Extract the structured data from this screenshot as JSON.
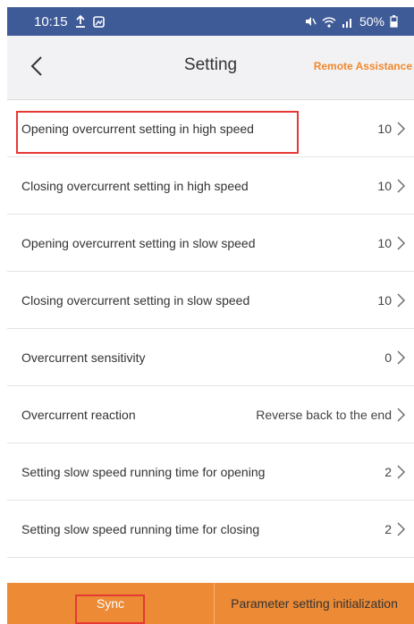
{
  "status_bar": {
    "time": "10:15",
    "battery": "50%",
    "icons": [
      "upload-icon",
      "image-icon",
      "mute-icon",
      "wifi-icon",
      "signal-icon",
      "battery-icon"
    ]
  },
  "header": {
    "title": "Setting",
    "back_icon": "chevron-left-icon",
    "remote_assistance": "Remote Assistance"
  },
  "settings": [
    {
      "label": "Opening overcurrent setting in high speed",
      "value": "10"
    },
    {
      "label": "Closing overcurrent setting in high speed",
      "value": "10"
    },
    {
      "label": "Opening overcurrent setting in slow speed",
      "value": "10"
    },
    {
      "label": "Closing overcurrent setting in slow speed",
      "value": "10"
    },
    {
      "label": "Overcurrent sensitivity",
      "value": "0"
    },
    {
      "label": "Overcurrent reaction",
      "value": "Reverse back to the end"
    },
    {
      "label": "Setting slow speed running time for opening",
      "value": "2"
    },
    {
      "label": "Setting slow speed running time for closing",
      "value": "2"
    }
  ],
  "bottom_bar": {
    "sync_label": "Sync",
    "init_label": "Parameter setting initialization"
  },
  "colors": {
    "status_bar": "#3f5b97",
    "accent_orange": "#ec8a35",
    "highlight_red": "#e53935"
  }
}
